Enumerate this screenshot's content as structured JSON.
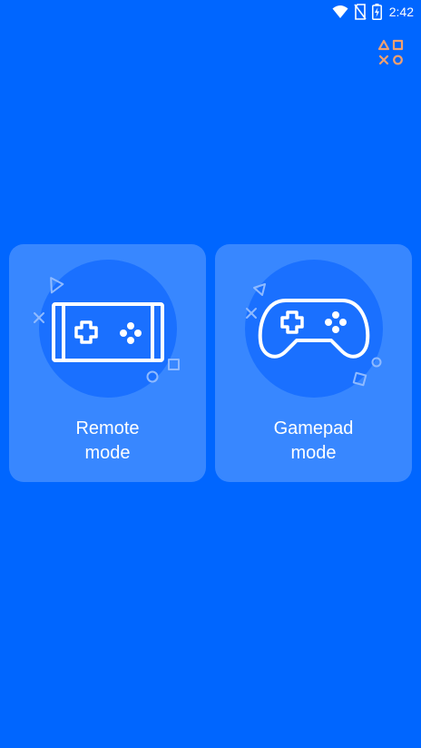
{
  "status_bar": {
    "time": "2:42",
    "icons": [
      "wifi-icon",
      "no-sim-icon",
      "battery-charging-icon"
    ]
  },
  "header": {
    "ps_icon": "playstation-symbols-icon",
    "ps_icon_color": "#f0a070"
  },
  "colors": {
    "background": "#0066ff",
    "card": "#3a8bff",
    "circle": "#1a70ff"
  },
  "modes": [
    {
      "label": "Remote\nmode",
      "icon": "remote-device-icon"
    },
    {
      "label": "Gamepad\nmode",
      "icon": "gamepad-icon"
    }
  ]
}
